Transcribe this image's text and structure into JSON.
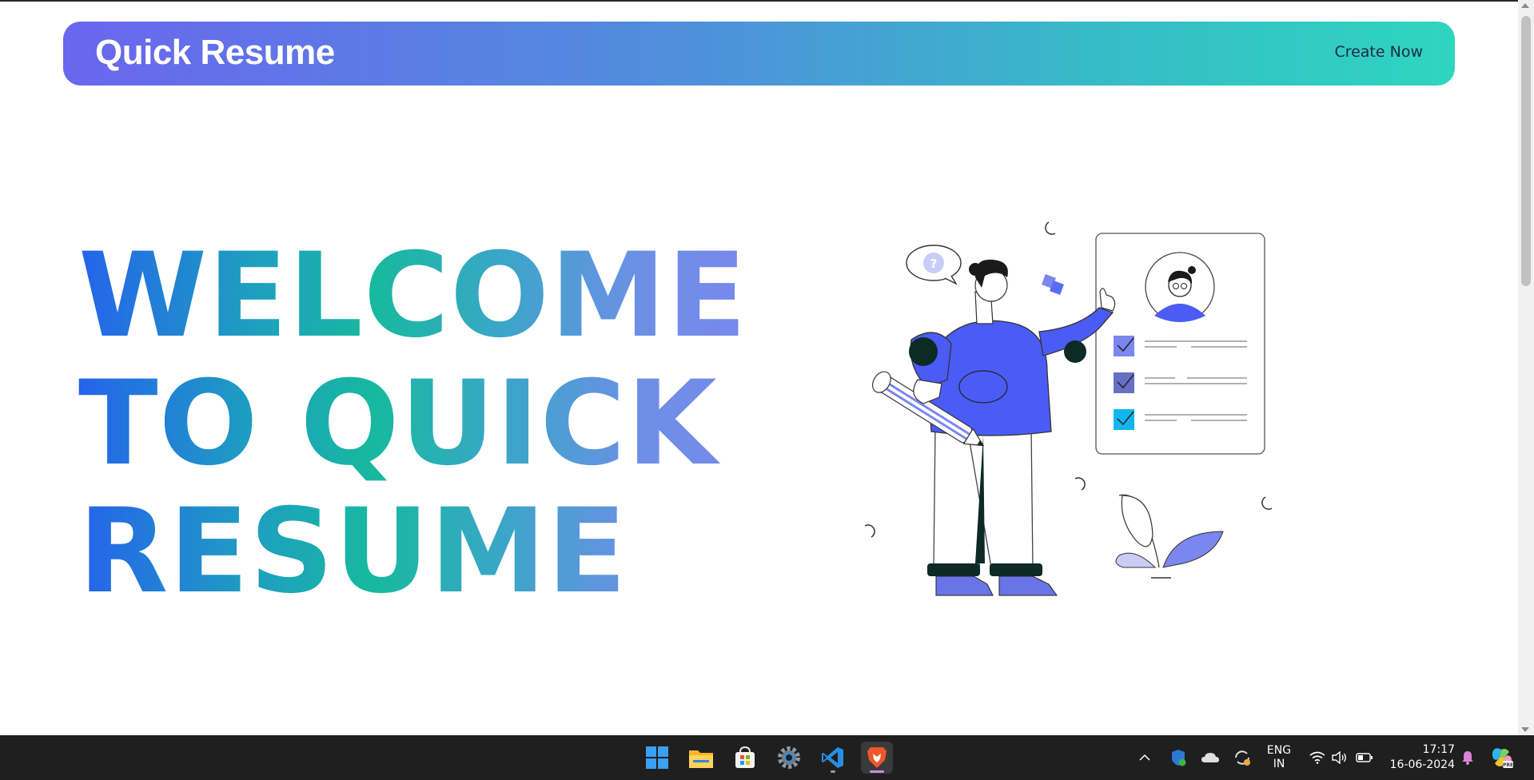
{
  "navbar": {
    "brand": "Quick Resume",
    "create_now": "Create Now"
  },
  "hero": {
    "line1": "WELCOME",
    "line2": "TO QUICK",
    "line3": "RESUME"
  },
  "illustration": {
    "speech_bubble_text": "?"
  },
  "taskbar": {
    "apps": [
      "start-icon",
      "file-explorer-icon",
      "microsoft-store-icon",
      "settings-icon",
      "vscode-icon",
      "brave-browser-icon"
    ],
    "tray": {
      "lang_top": "ENG",
      "lang_bottom": "IN",
      "time": "17:17",
      "date": "16-06-2024"
    }
  },
  "colors": {
    "gradient_start": "#6a66ee",
    "gradient_end": "#2fd5bf",
    "accent_blue": "#4a5cf5"
  }
}
